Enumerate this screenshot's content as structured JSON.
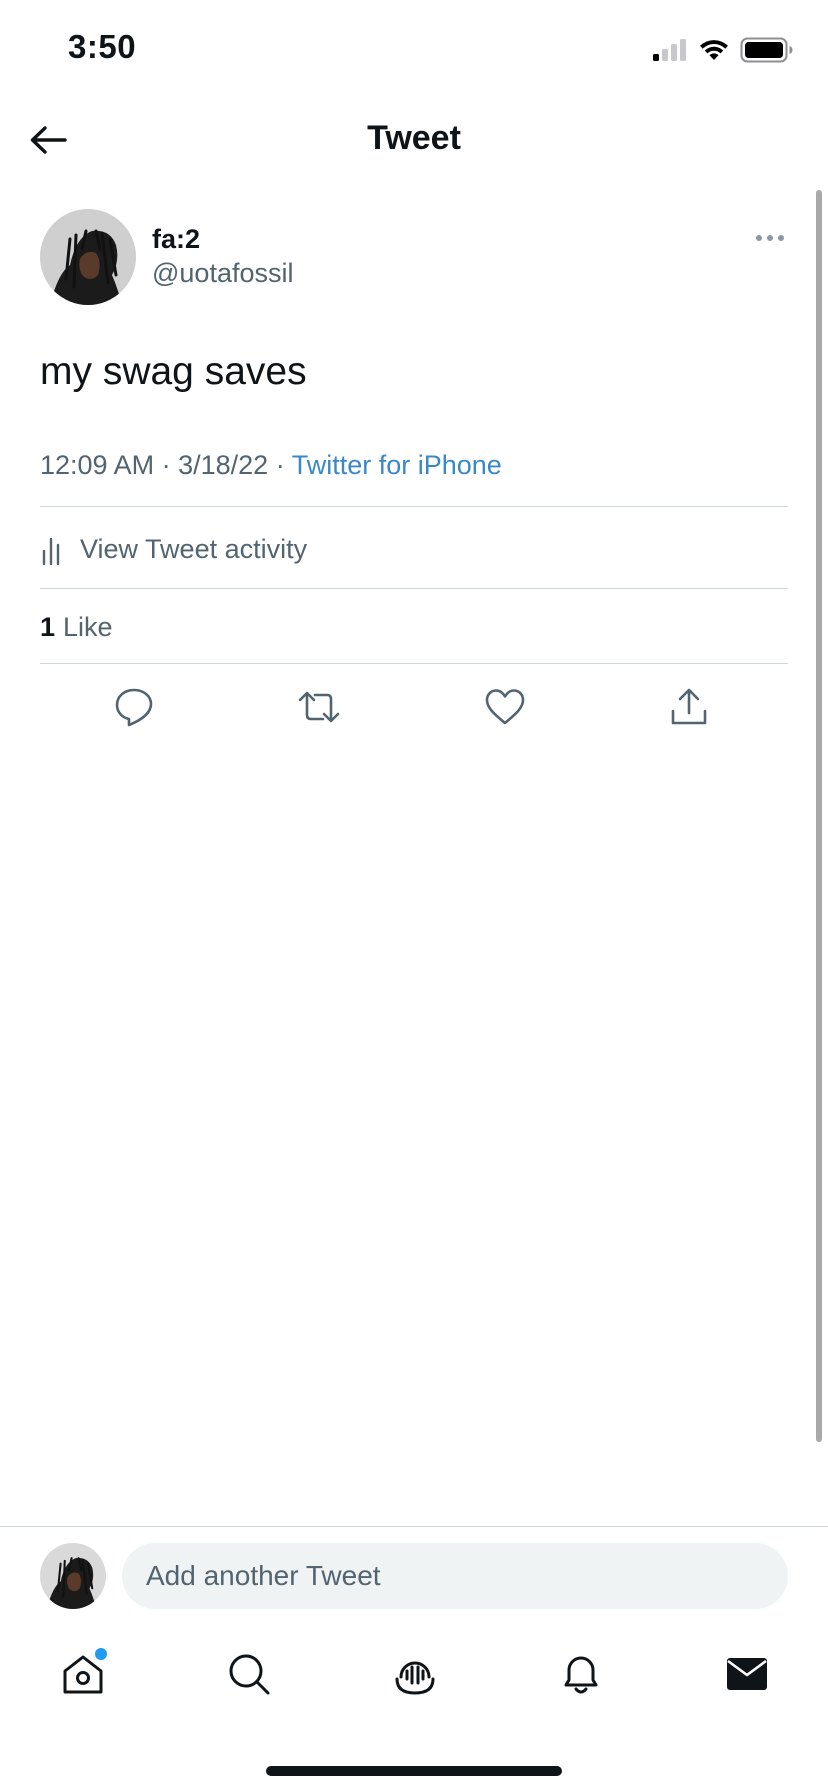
{
  "status_bar": {
    "time": "3:50",
    "icons": [
      "cellular-signal-icon",
      "wifi-icon",
      "battery-icon"
    ]
  },
  "header": {
    "title": "Tweet",
    "back_icon": "arrow-left-icon"
  },
  "tweet": {
    "author_name": "fa:2",
    "author_handle": "@uotafossil",
    "text": "my swag saves",
    "time": "12:09 AM",
    "date": "3/18/22",
    "separator": "·",
    "source": "Twitter for iPhone",
    "activity_label": "View Tweet activity",
    "likes_count": "1",
    "likes_label": "Like",
    "actions": [
      "reply-icon",
      "retweet-icon",
      "like-icon",
      "share-icon"
    ]
  },
  "composer": {
    "placeholder": "Add another Tweet"
  },
  "tabbar": {
    "items": [
      "home-icon",
      "search-icon",
      "spaces-icon",
      "notifications-icon",
      "messages-icon"
    ],
    "home_has_notification": true
  },
  "colors": {
    "accent": "#1d9bf0",
    "link": "#3b88c9",
    "secondary_text": "#536471",
    "primary_text": "#0f1419",
    "divider": "#cfd9de",
    "input_bg": "#eff3f4"
  }
}
